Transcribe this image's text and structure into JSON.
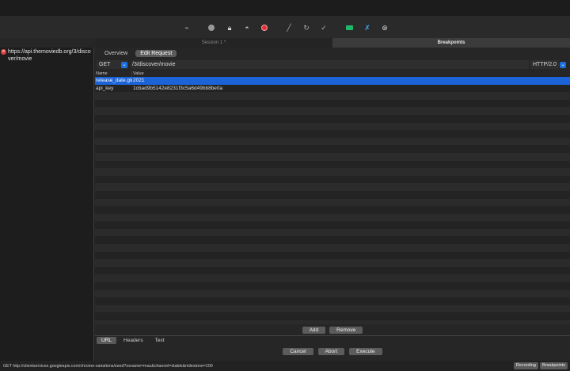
{
  "toolbar": {
    "icons": [
      "broom-icon",
      "record-icon",
      "lock-icon",
      "turtle-icon",
      "breakpoint-icon",
      "pen-icon",
      "refresh-icon",
      "check-icon",
      "basket-icon",
      "tools-icon",
      "settings-icon"
    ]
  },
  "tabs": {
    "session": "Session 1 *",
    "breakpoints": "Breakpoints"
  },
  "left": {
    "items": [
      {
        "url": "https://api.themoviedb.org/3/discover/movie"
      }
    ]
  },
  "subtabs": {
    "overview": "Overview",
    "edit_request": "Edit Request"
  },
  "request": {
    "method": "GET",
    "path": "/3/discover/movie",
    "protocol": "HTTP/2.0"
  },
  "params": {
    "headers": {
      "name": "Name",
      "value": "Value"
    },
    "rows": [
      {
        "name": "release_date.gte",
        "value": "2021"
      },
      {
        "name": "api_key",
        "value": "1cbad9b5142e8231f3c5a6d49bb8be0a"
      }
    ]
  },
  "buttons": {
    "add": "Add",
    "remove": "Remove",
    "cancel": "Cancel",
    "abort": "Abort",
    "execute": "Execute"
  },
  "bottom_tabs": {
    "url": "URL",
    "headers": "Headers",
    "text": "Text"
  },
  "status": {
    "text": "GET http://clientservices.googleapis.com/chrome-variations/seed?osname=mac&channel=stable&milestone=100",
    "recording": "Recording",
    "breakpoints": "Breakpoints"
  }
}
